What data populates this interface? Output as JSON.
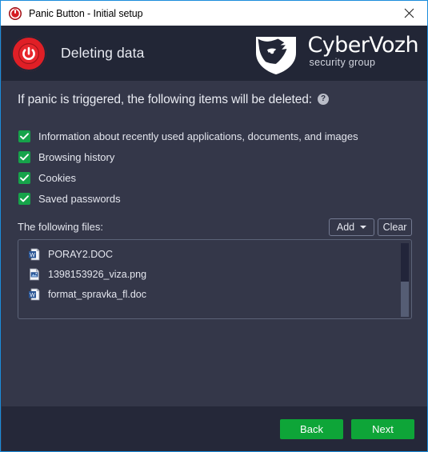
{
  "window": {
    "titlebar": {
      "icon": "power-button-icon",
      "title": "Panic Button - Initial setup",
      "close_label": "close-icon"
    },
    "border_color": "#1b8cdb"
  },
  "header": {
    "power_icon": "power-button-icon",
    "title": "Deleting data",
    "brand": {
      "shield_icon": "shield-wolf-icon",
      "name": "CyberVozh",
      "tagline": "security group"
    },
    "background_color": "#222636"
  },
  "main": {
    "lede": "If panic is triggered, the following items will be deleted:",
    "help_icon_label": "?",
    "checkbox_color": "#16a34a",
    "items": [
      {
        "label": "Information about recently used applications, documents, and images",
        "checked": true
      },
      {
        "label": "Browsing history",
        "checked": true
      },
      {
        "label": "Cookies",
        "checked": true
      },
      {
        "label": "Saved passwords",
        "checked": true
      }
    ],
    "files_section": {
      "label": "The following files:",
      "add_button": "Add",
      "clear_button": "Clear",
      "files": [
        {
          "name": "PORAY2.DOC",
          "icon": "word-document-icon"
        },
        {
          "name": "1398153926_viza.png",
          "icon": "image-file-icon"
        },
        {
          "name": "format_spravka_fl.doc",
          "icon": "word-document-icon"
        }
      ]
    }
  },
  "footer": {
    "back_button": "Back",
    "next_button": "Next",
    "button_color": "#0ea538",
    "background_color": "#252839"
  }
}
